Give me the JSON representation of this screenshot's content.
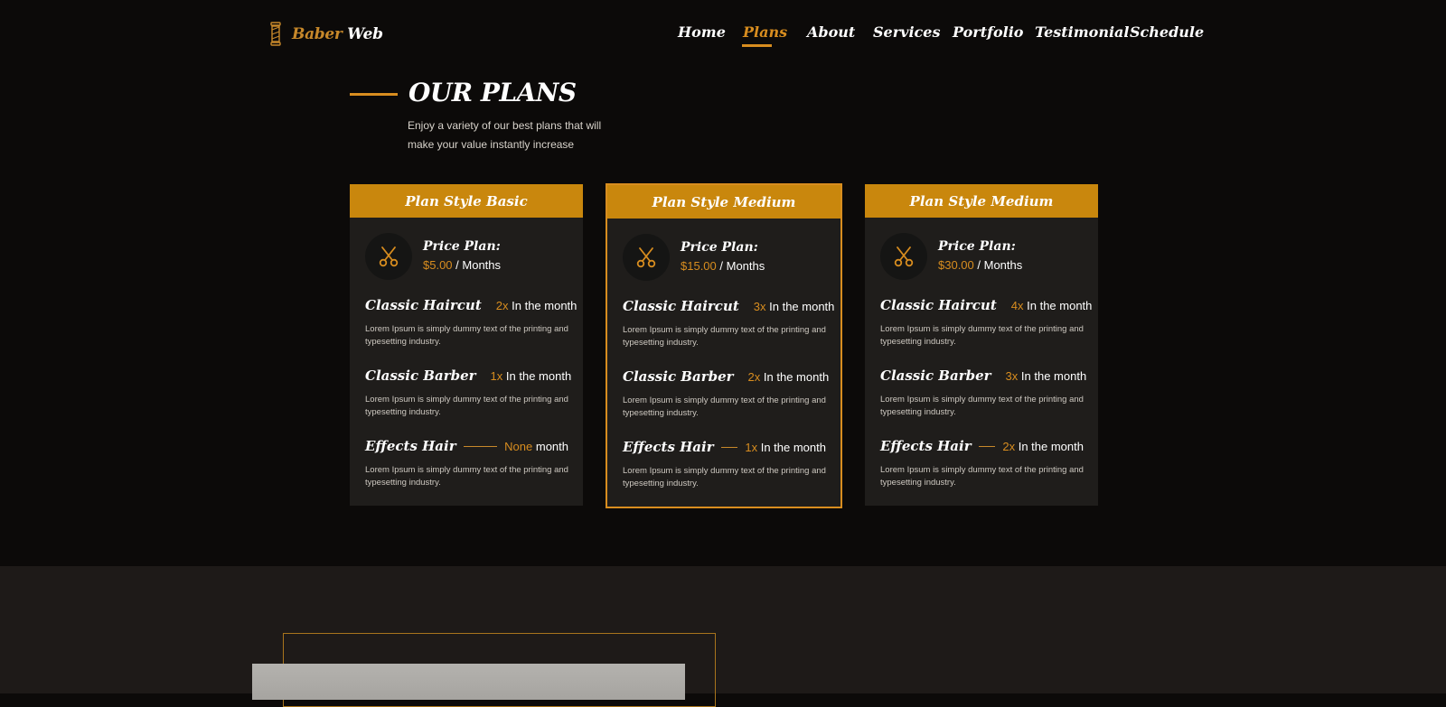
{
  "brand": {
    "first": "Baber",
    "second": "Web"
  },
  "nav": {
    "items": [
      {
        "label": "Home"
      },
      {
        "label": "Plans"
      },
      {
        "label": "About"
      },
      {
        "label": "Services"
      },
      {
        "label": "Portfolio"
      },
      {
        "label": "Testimonial"
      },
      {
        "label": "Schedule"
      }
    ],
    "active": "Plans"
  },
  "section": {
    "title": "OUR PLANS",
    "subtitle": "Enjoy a variety of our best plans that will make your value instantly increase"
  },
  "plans": [
    {
      "name": "Plan Style Basic",
      "price_label": "Price Plan:",
      "price": "$5.00",
      "period": "/ Months",
      "features": [
        {
          "name": "Classic Haircut",
          "qty": "2x",
          "unit": "In the month",
          "desc": "Lorem Ipsum is simply dummy text of the printing and typesetting industry."
        },
        {
          "name": "Classic Barber",
          "qty": "1x",
          "unit": "In the month",
          "desc": "Lorem Ipsum is simply dummy text of the printing and typesetting industry."
        },
        {
          "name": "Effects Hair",
          "qty": "None",
          "unit": "month",
          "desc": "Lorem Ipsum is simply dummy text of the printing and typesetting industry."
        }
      ]
    },
    {
      "name": "Plan Style Medium",
      "price_label": "Price Plan:",
      "price": "$15.00",
      "period": "/ Months",
      "features": [
        {
          "name": "Classic Haircut",
          "qty": "3x",
          "unit": "In the month",
          "desc": "Lorem Ipsum is simply dummy text of the printing and typesetting industry."
        },
        {
          "name": "Classic Barber",
          "qty": "2x",
          "unit": "In the month",
          "desc": "Lorem Ipsum is simply dummy text of the printing and typesetting industry."
        },
        {
          "name": "Effects Hair",
          "qty": "1x",
          "unit": "In the month",
          "desc": "Lorem Ipsum is simply dummy text of the printing and typesetting industry."
        }
      ]
    },
    {
      "name": "Plan Style Medium",
      "price_label": "Price Plan:",
      "price": "$30.00",
      "period": "/ Months",
      "features": [
        {
          "name": "Classic Haircut",
          "qty": "4x",
          "unit": "In the month",
          "desc": "Lorem Ipsum is simply dummy text of the printing and typesetting industry."
        },
        {
          "name": "Classic Barber",
          "qty": "3x",
          "unit": "In the month",
          "desc": "Lorem Ipsum is simply dummy text of the printing and typesetting industry."
        },
        {
          "name": "Effects Hair",
          "qty": "2x",
          "unit": "In the month",
          "desc": "Lorem Ipsum is simply dummy text of the printing and typesetting industry."
        }
      ]
    }
  ],
  "icons": {
    "logo": "barber-pole-icon",
    "plan": "scissors-icon"
  },
  "colors": {
    "accent": "#d88d1f",
    "card_header": "#c9870d",
    "background": "#0c0a09",
    "card_background": "#1f1d1b"
  }
}
